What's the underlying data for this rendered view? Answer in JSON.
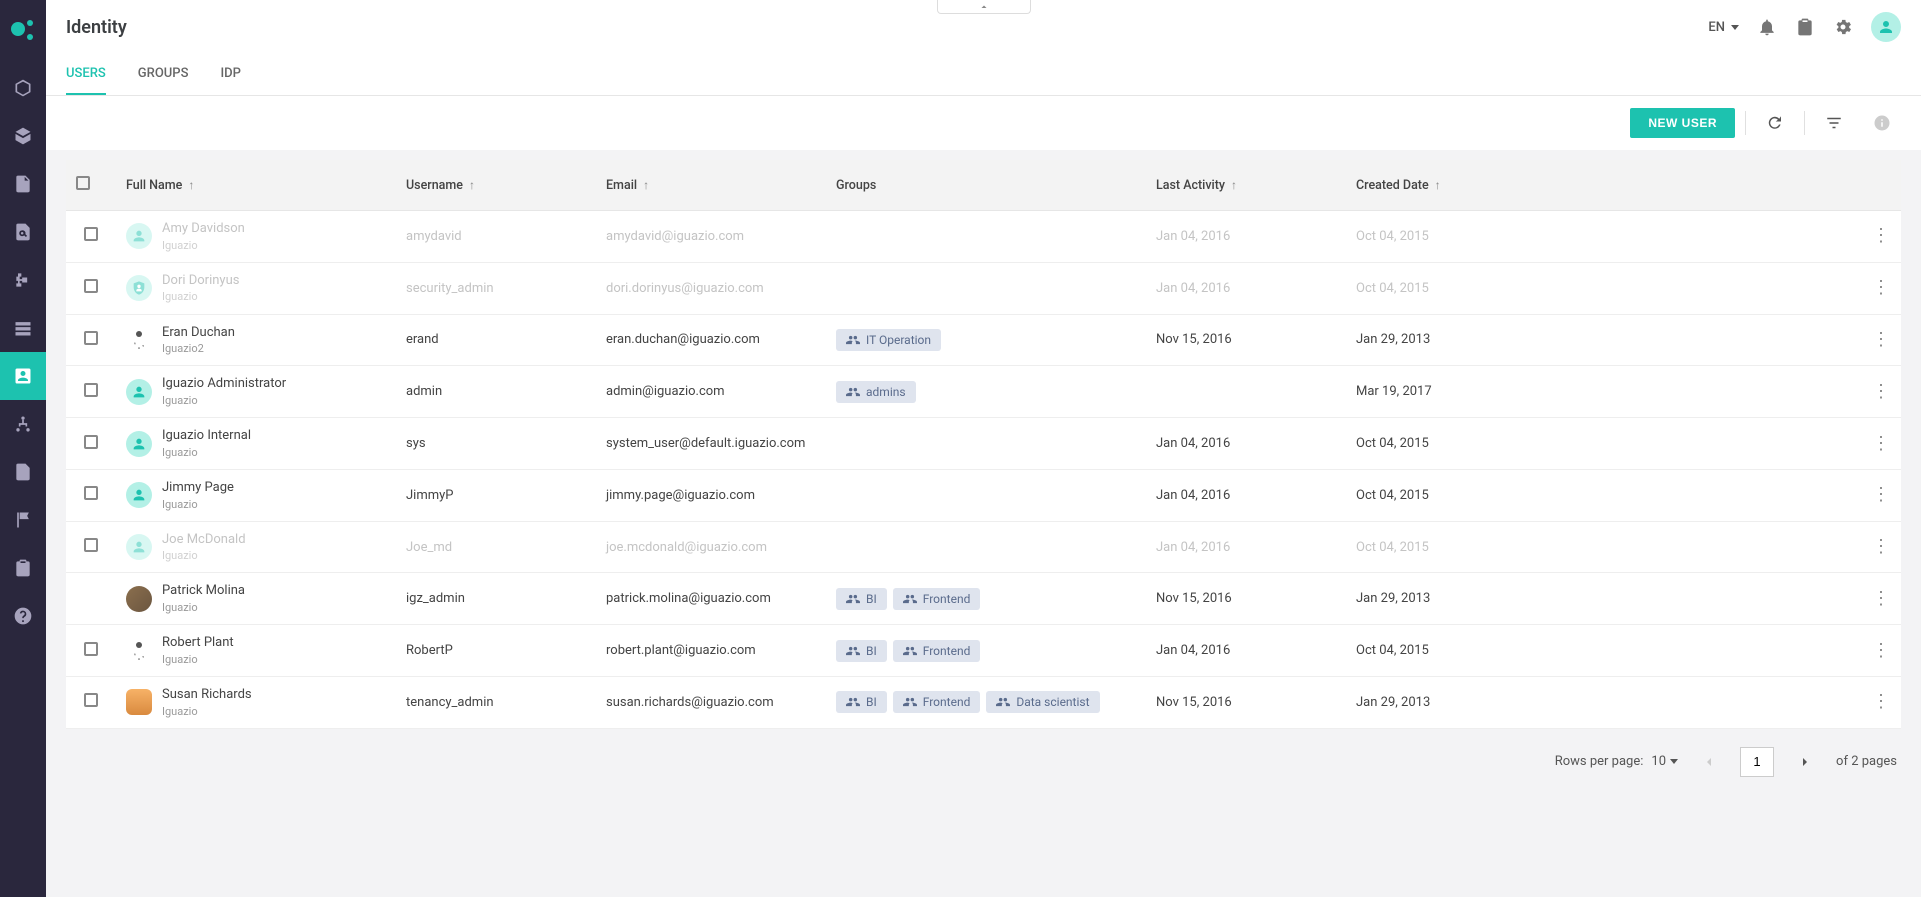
{
  "header": {
    "title": "Identity",
    "language": "EN"
  },
  "tabs": {
    "users": "USERS",
    "groups": "GROUPS",
    "idp": "IDP"
  },
  "toolbar": {
    "new_user": "NEW USER"
  },
  "columns": {
    "full_name": "Full Name",
    "username": "Username",
    "email": "Email",
    "groups": "Groups",
    "last_activity": "Last Activity",
    "created_date": "Created Date"
  },
  "rows": [
    {
      "name": "Amy Davidson",
      "tenant": "Iguazio",
      "username": "amydavid",
      "email": "amydavid@iguazio.com",
      "groups": [],
      "last": "Jan 04, 2016",
      "created": "Oct 04, 2015",
      "disabled": true,
      "avatar": "green"
    },
    {
      "name": "Dori Dorinyus",
      "tenant": "Iguazio",
      "username": "security_admin",
      "email": "dori.dorinyus@iguazio.com",
      "groups": [],
      "last": "Jan 04, 2016",
      "created": "Oct 04, 2015",
      "disabled": true,
      "avatar": "green",
      "shield": true
    },
    {
      "name": "Eran Duchan",
      "tenant": "Iguazio2",
      "username": "erand",
      "email": "eran.duchan@iguazio.com",
      "groups": [
        "IT Operation"
      ],
      "last": "Nov 15, 2016",
      "created": "Jan 29, 2013",
      "disabled": false,
      "avatar": "star"
    },
    {
      "name": "Iguazio Administrator",
      "tenant": "Iguazio",
      "username": "admin",
      "email": "admin@iguazio.com",
      "groups": [
        "admins"
      ],
      "last": "",
      "created": "Mar 19, 2017",
      "disabled": false,
      "avatar": "green"
    },
    {
      "name": "Iguazio Internal",
      "tenant": "Iguazio",
      "username": "sys",
      "email": "system_user@default.iguazio.com",
      "groups": [],
      "last": "Jan 04, 2016",
      "created": "Oct 04, 2015",
      "disabled": false,
      "avatar": "green"
    },
    {
      "name": "Jimmy Page",
      "tenant": "Iguazio",
      "username": "JimmyP",
      "email": "jimmy.page@iguazio.com",
      "groups": [],
      "last": "Jan 04, 2016",
      "created": "Oct 04, 2015",
      "disabled": false,
      "avatar": "green"
    },
    {
      "name": "Joe McDonald",
      "tenant": "Iguazio",
      "username": "Joe_md",
      "email": "joe.mcdonald@iguazio.com",
      "groups": [],
      "last": "Jan 04, 2016",
      "created": "Oct 04, 2015",
      "disabled": true,
      "avatar": "green"
    },
    {
      "name": "Patrick Molina",
      "tenant": "Iguazio",
      "username": "igz_admin",
      "email": "patrick.molina@iguazio.com",
      "groups": [
        "BI",
        "Frontend"
      ],
      "last": "Nov 15, 2016",
      "created": "Jan 29, 2013",
      "disabled": false,
      "avatar": "brown",
      "nocheck": true
    },
    {
      "name": "Robert Plant",
      "tenant": "Iguazio",
      "username": "RobertP",
      "email": "robert.plant@iguazio.com",
      "groups": [
        "BI",
        "Frontend"
      ],
      "last": "Jan 04, 2016",
      "created": "Oct 04, 2015",
      "disabled": false,
      "avatar": "star"
    },
    {
      "name": "Susan Richards",
      "tenant": "Iguazio",
      "username": "tenancy_admin",
      "email": "susan.richards@iguazio.com",
      "groups": [
        "BI",
        "Frontend",
        "Data scientist"
      ],
      "last": "Nov 15, 2016",
      "created": "Jan 29, 2013",
      "disabled": false,
      "avatar": "orange"
    }
  ],
  "pagination": {
    "rpp_label": "Rows per page:",
    "rpp_value": "10",
    "current": "1",
    "total_label": "of 2 pages"
  }
}
